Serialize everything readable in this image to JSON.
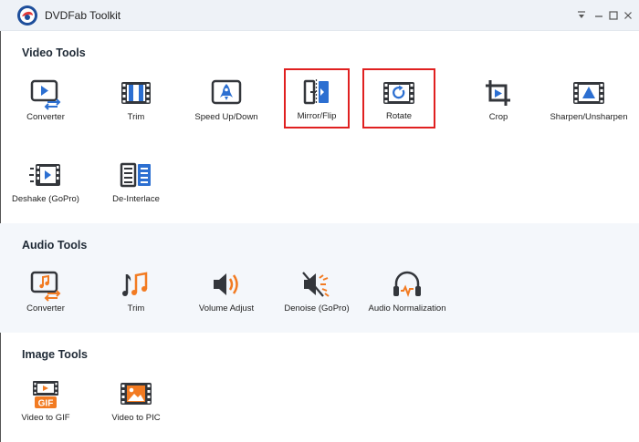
{
  "app": {
    "title": "DVDFab Toolkit"
  },
  "colors": {
    "blue": "#2c6fd1",
    "dark": "#33363b",
    "orange": "#f27b22",
    "highlight": "#e02020"
  },
  "sections": {
    "video": {
      "title": "Video Tools",
      "items": [
        {
          "label": "Converter",
          "icon": "converter-icon"
        },
        {
          "label": "Trim",
          "icon": "film-trim-icon"
        },
        {
          "label": "Speed Up/Down",
          "icon": "rocket-icon"
        },
        {
          "label": "Mirror/Flip",
          "icon": "mirror-flip-icon"
        },
        {
          "label": "Rotate",
          "icon": "rotate-icon"
        },
        {
          "label": "Crop",
          "icon": "crop-icon"
        },
        {
          "label": "Sharpen/Unsharpen",
          "icon": "sharpen-icon"
        },
        {
          "label": "Deshake (GoPro)",
          "icon": "deshake-icon"
        },
        {
          "label": "De-Interlace",
          "icon": "deinterlace-icon"
        }
      ]
    },
    "audio": {
      "title": "Audio Tools",
      "items": [
        {
          "label": "Converter",
          "icon": "audio-converter-icon"
        },
        {
          "label": "Trim",
          "icon": "audio-trim-icon"
        },
        {
          "label": "Volume Adjust",
          "icon": "speaker-icon"
        },
        {
          "label": "Denoise (GoPro)",
          "icon": "denoise-icon"
        },
        {
          "label": "Audio Normalization",
          "icon": "headphones-icon"
        }
      ]
    },
    "image": {
      "title": "Image Tools",
      "items": [
        {
          "label": "Video to GIF",
          "icon": "gif-icon"
        },
        {
          "label": "Video to PIC",
          "icon": "picture-icon"
        }
      ]
    }
  }
}
